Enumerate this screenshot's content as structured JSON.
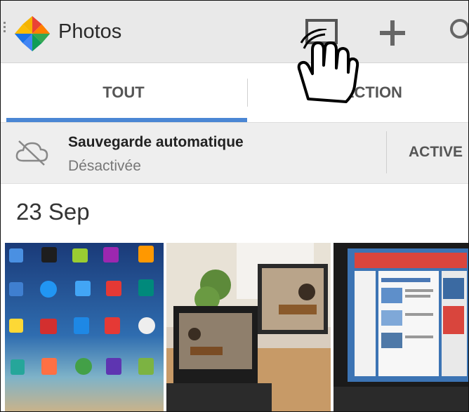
{
  "app": {
    "title": "Photos"
  },
  "toolbar": {
    "icons": [
      "menu-dots-icon",
      "photos-logo-icon",
      "cast-icon",
      "add-icon",
      "search-icon"
    ]
  },
  "tabs": [
    {
      "label": "TOUT",
      "selected": true
    },
    {
      "label": "SÉLECTION",
      "visible_text": "ÉLECTION",
      "selected": false
    }
  ],
  "backup": {
    "title": "Sauvegarde automatique",
    "status": "Désactivée",
    "action": "ACTIVE",
    "icon": "cloud-off-icon"
  },
  "gallery": {
    "date_header": "23 Sep",
    "thumbnails": [
      "tablet-homescreen-photo",
      "guitar-player-laptop-photo",
      "computer-monitor-photo"
    ]
  },
  "colors": {
    "actionbar_bg": "#e9e9e9",
    "tab_indicator": "#4a86d4",
    "backup_bg": "#eeeeee"
  },
  "overlay": {
    "icon": "hand-pointer-icon"
  }
}
